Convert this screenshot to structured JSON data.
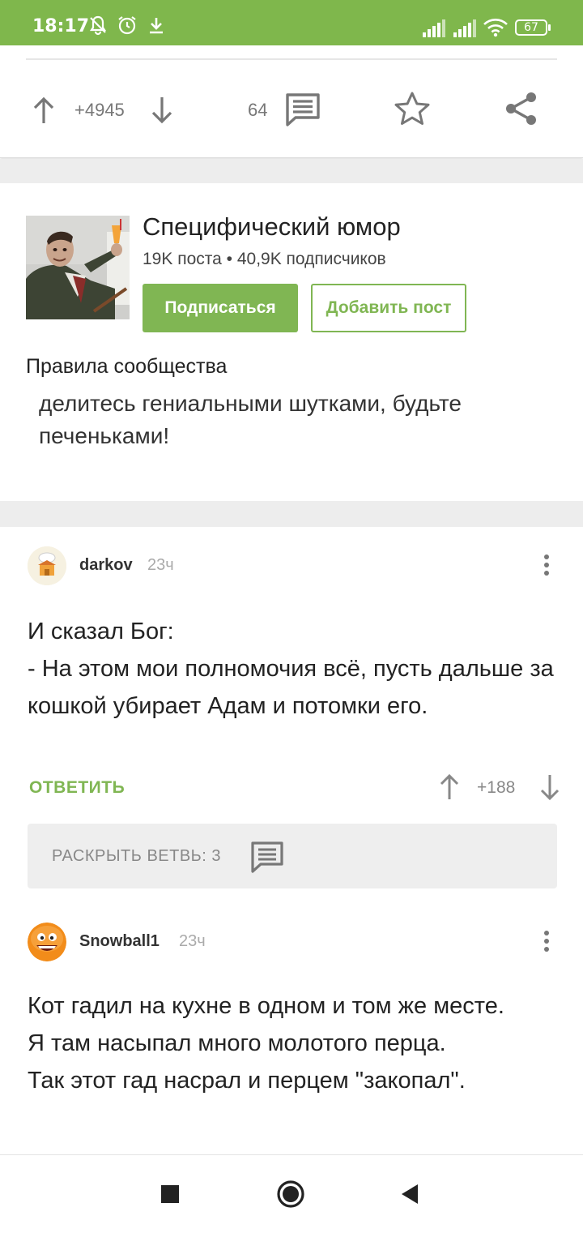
{
  "status_bar": {
    "time": "18:17",
    "battery": "67",
    "icons": [
      "bell-off-icon",
      "alarm-icon",
      "download-icon",
      "signal-icon",
      "signal-icon",
      "wifi-icon",
      "battery-icon"
    ]
  },
  "post_actions": {
    "rating": "+4945",
    "comments_count": "64"
  },
  "community": {
    "title": "Специфический юмор",
    "stats": "19K поста • 40,9K подписчиков",
    "subscribe_label": "Подписаться",
    "add_post_label": "Добавить пост",
    "rules_title": "Правила сообщества",
    "rules_text": "делитесь гениальными шутками, будьте печеньками!"
  },
  "comments": [
    {
      "user": "darkov",
      "time": "23ч",
      "lines": [
        "И сказал Бог:",
        "- На этом мои полномочия всё, пусть дальше за кошкой убирает Адам и потомки его."
      ],
      "reply_label": "ОТВЕТИТЬ",
      "rating": "+188"
    },
    {
      "user": "Snowball1",
      "time": "23ч",
      "lines": [
        "Кот гадил на кухне в одном и том же месте.",
        "Я там насыпал много молотого перца.",
        "Так этот гад насрал и перцем \"закопал\"."
      ]
    }
  ],
  "branch": {
    "label": "РАСКРЫТЬ ВЕТВЬ: 3"
  },
  "colors": {
    "accent": "#80b653",
    "status_bar": "#7fb74c"
  }
}
